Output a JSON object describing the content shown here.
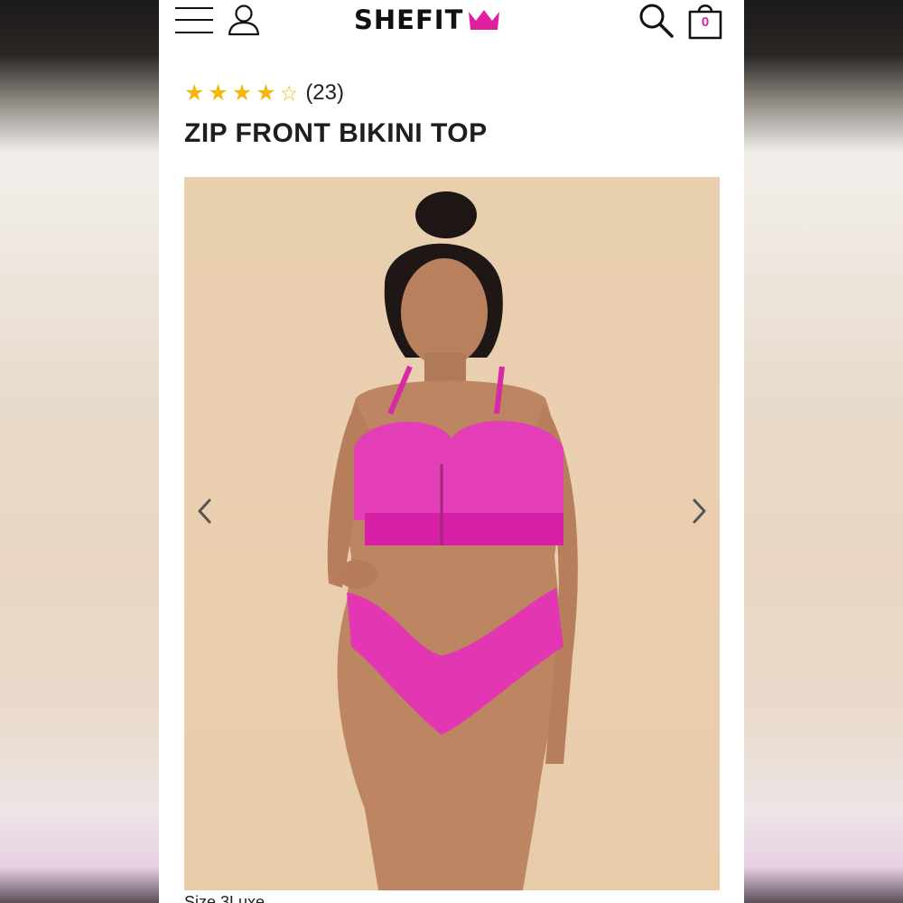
{
  "brand": {
    "name": "SHEFIT",
    "accent_color": "#e01f9e"
  },
  "header": {
    "menu_icon": "hamburger-menu-icon",
    "account_icon": "user-icon",
    "search_icon": "search-icon",
    "cart_icon": "shopping-bag-icon",
    "cart_count": "0"
  },
  "product": {
    "rating_value": 4,
    "rating_max": 5,
    "review_count": "(23)",
    "title": "ZIP FRONT BIKINI TOP",
    "image_alt_icon": "product-photo",
    "prev_icon": "chevron-left-icon",
    "next_icon": "chevron-right-icon",
    "caption": "Size 3Luxe"
  }
}
